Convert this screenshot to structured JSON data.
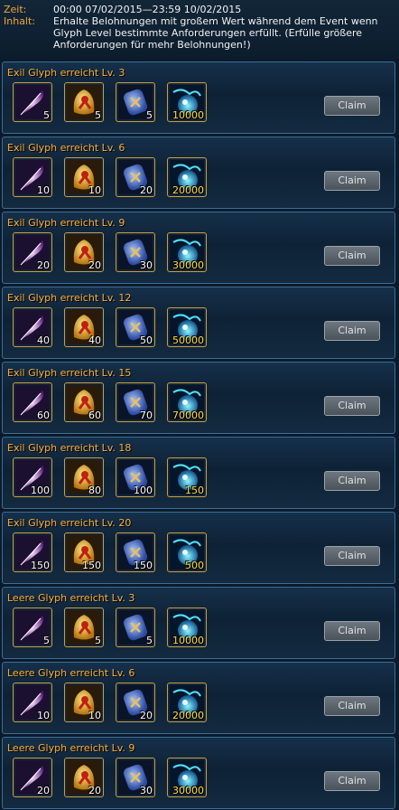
{
  "header": {
    "time_label": "Zeit:",
    "time_value": "00:00 07/02/2015—23:59 10/02/2015",
    "content_label": "Inhalt:",
    "content_value": "Erhalte Belohnungen mit großem Wert während dem Event wenn Glyph Level bestimmte Anforderungen erfüllt. (Erfülle größere Anforderungen für mehr Belohnungen!)"
  },
  "claim_label": "Claim",
  "colors": {
    "title": "#ffb038",
    "label": "#f0a63a",
    "frame": "#3d6d95"
  },
  "item_icons": [
    "feather-icon",
    "gold-rune-icon",
    "blue-rune-icon",
    "blue-orb-icon"
  ],
  "rewards": [
    {
      "title": "Exil Glyph erreicht Lv. 3",
      "counts": [
        "5",
        "5",
        "5",
        "10000"
      ]
    },
    {
      "title": "Exil Glyph erreicht Lv. 6",
      "counts": [
        "10",
        "10",
        "20",
        "20000"
      ]
    },
    {
      "title": "Exil Glyph erreicht Lv. 9",
      "counts": [
        "20",
        "20",
        "30",
        "30000"
      ]
    },
    {
      "title": "Exil Glyph erreicht Lv. 12",
      "counts": [
        "40",
        "40",
        "50",
        "50000"
      ]
    },
    {
      "title": "Exil Glyph erreicht Lv. 15",
      "counts": [
        "60",
        "60",
        "70",
        "70000"
      ]
    },
    {
      "title": "Exil Glyph erreicht Lv. 18",
      "counts": [
        "100",
        "80",
        "100",
        "150"
      ]
    },
    {
      "title": "Exil Glyph erreicht Lv. 20",
      "counts": [
        "150",
        "150",
        "150",
        "500"
      ]
    },
    {
      "title": "Leere Glyph erreicht Lv. 3",
      "counts": [
        "5",
        "5",
        "5",
        "10000"
      ]
    },
    {
      "title": "Leere Glyph erreicht Lv. 6",
      "counts": [
        "10",
        "10",
        "20",
        "20000"
      ]
    },
    {
      "title": "Leere Glyph erreicht Lv. 9",
      "counts": [
        "20",
        "20",
        "30",
        "30000"
      ]
    }
  ]
}
